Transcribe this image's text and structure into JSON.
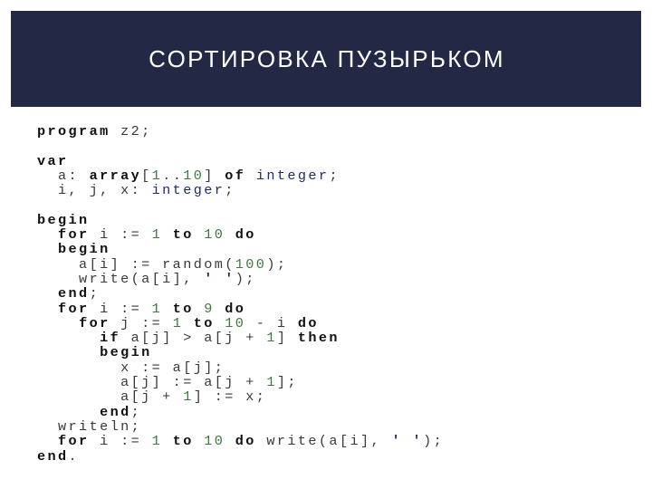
{
  "slide": {
    "title": "СОРТИРОВКА ПУЗЫРЬКОМ",
    "colors": {
      "header_bg": "#232845",
      "title_text": "#ffffff",
      "keyword": "#111111",
      "number": "#3d7a3d",
      "type": "#1f2a6e",
      "plain": "#3a3a3a"
    },
    "code_lines": [
      [
        {
          "t": "kw",
          "v": "program"
        },
        {
          "t": "plain",
          "v": " z2;"
        }
      ],
      [],
      [
        {
          "t": "kw",
          "v": "var"
        }
      ],
      [
        {
          "t": "plain",
          "v": "  a: "
        },
        {
          "t": "kw",
          "v": "array"
        },
        {
          "t": "plain",
          "v": "["
        },
        {
          "t": "num",
          "v": "1"
        },
        {
          "t": "plain",
          "v": ".."
        },
        {
          "t": "num",
          "v": "10"
        },
        {
          "t": "plain",
          "v": "] "
        },
        {
          "t": "kw",
          "v": "of"
        },
        {
          "t": "plain",
          "v": " "
        },
        {
          "t": "type",
          "v": "integer"
        },
        {
          "t": "plain",
          "v": ";"
        }
      ],
      [
        {
          "t": "plain",
          "v": "  i, j, x: "
        },
        {
          "t": "type",
          "v": "integer"
        },
        {
          "t": "plain",
          "v": ";"
        }
      ],
      [],
      [
        {
          "t": "kw",
          "v": "begin"
        }
      ],
      [
        {
          "t": "plain",
          "v": "  "
        },
        {
          "t": "kw",
          "v": "for"
        },
        {
          "t": "plain",
          "v": " i := "
        },
        {
          "t": "num",
          "v": "1"
        },
        {
          "t": "plain",
          "v": " "
        },
        {
          "t": "kw",
          "v": "to"
        },
        {
          "t": "plain",
          "v": " "
        },
        {
          "t": "num",
          "v": "10"
        },
        {
          "t": "plain",
          "v": " "
        },
        {
          "t": "kw",
          "v": "do"
        }
      ],
      [
        {
          "t": "plain",
          "v": "  "
        },
        {
          "t": "kw",
          "v": "begin"
        }
      ],
      [
        {
          "t": "plain",
          "v": "    a[i] := random("
        },
        {
          "t": "num",
          "v": "100"
        },
        {
          "t": "plain",
          "v": ");"
        }
      ],
      [
        {
          "t": "plain",
          "v": "    write(a[i], "
        },
        {
          "t": "str",
          "v": "' '"
        },
        {
          "t": "plain",
          "v": ");"
        }
      ],
      [
        {
          "t": "plain",
          "v": "  "
        },
        {
          "t": "kw",
          "v": "end"
        },
        {
          "t": "plain",
          "v": ";"
        }
      ],
      [
        {
          "t": "plain",
          "v": "  "
        },
        {
          "t": "kw",
          "v": "for"
        },
        {
          "t": "plain",
          "v": " i := "
        },
        {
          "t": "num",
          "v": "1"
        },
        {
          "t": "plain",
          "v": " "
        },
        {
          "t": "kw",
          "v": "to"
        },
        {
          "t": "plain",
          "v": " "
        },
        {
          "t": "num",
          "v": "9"
        },
        {
          "t": "plain",
          "v": " "
        },
        {
          "t": "kw",
          "v": "do"
        }
      ],
      [
        {
          "t": "plain",
          "v": "    "
        },
        {
          "t": "kw",
          "v": "for"
        },
        {
          "t": "plain",
          "v": " j := "
        },
        {
          "t": "num",
          "v": "1"
        },
        {
          "t": "plain",
          "v": " "
        },
        {
          "t": "kw",
          "v": "to"
        },
        {
          "t": "plain",
          "v": " "
        },
        {
          "t": "num",
          "v": "10"
        },
        {
          "t": "plain",
          "v": " - i "
        },
        {
          "t": "kw",
          "v": "do"
        }
      ],
      [
        {
          "t": "plain",
          "v": "      "
        },
        {
          "t": "kw",
          "v": "if"
        },
        {
          "t": "plain",
          "v": " a[j] > a[j + "
        },
        {
          "t": "num",
          "v": "1"
        },
        {
          "t": "plain",
          "v": "] "
        },
        {
          "t": "kw",
          "v": "then"
        }
      ],
      [
        {
          "t": "plain",
          "v": "      "
        },
        {
          "t": "kw",
          "v": "begin"
        }
      ],
      [
        {
          "t": "plain",
          "v": "        x := a[j];"
        }
      ],
      [
        {
          "t": "plain",
          "v": "        a[j] := a[j + "
        },
        {
          "t": "num",
          "v": "1"
        },
        {
          "t": "plain",
          "v": "];"
        }
      ],
      [
        {
          "t": "plain",
          "v": "        a[j + "
        },
        {
          "t": "num",
          "v": "1"
        },
        {
          "t": "plain",
          "v": "] := x;"
        }
      ],
      [
        {
          "t": "plain",
          "v": "      "
        },
        {
          "t": "kw",
          "v": "end"
        },
        {
          "t": "plain",
          "v": ";"
        }
      ],
      [
        {
          "t": "plain",
          "v": "  writeln;"
        }
      ],
      [
        {
          "t": "plain",
          "v": "  "
        },
        {
          "t": "kw",
          "v": "for"
        },
        {
          "t": "plain",
          "v": " i := "
        },
        {
          "t": "num",
          "v": "1"
        },
        {
          "t": "plain",
          "v": " "
        },
        {
          "t": "kw",
          "v": "to"
        },
        {
          "t": "plain",
          "v": " "
        },
        {
          "t": "num",
          "v": "10"
        },
        {
          "t": "plain",
          "v": " "
        },
        {
          "t": "kw",
          "v": "do"
        },
        {
          "t": "plain",
          "v": " write(a[i], "
        },
        {
          "t": "str",
          "v": "' '"
        },
        {
          "t": "plain",
          "v": ");"
        }
      ],
      [
        {
          "t": "kw",
          "v": "end"
        },
        {
          "t": "plain",
          "v": "."
        }
      ]
    ]
  }
}
